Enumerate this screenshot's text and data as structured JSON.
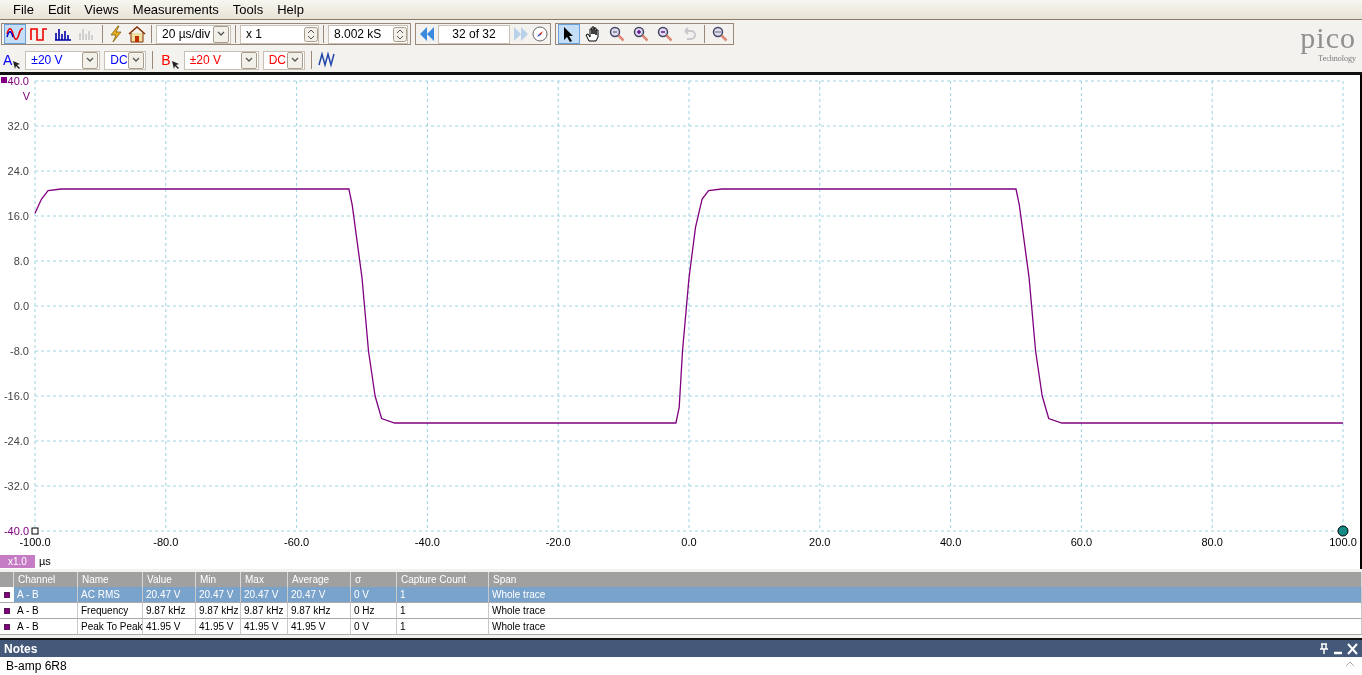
{
  "menu": [
    {
      "label": "File"
    },
    {
      "label": "Edit"
    },
    {
      "label": "Views"
    },
    {
      "label": "Measurements"
    },
    {
      "label": "Tools"
    },
    {
      "label": "Help"
    }
  ],
  "toolbar": {
    "view_modes": [
      {
        "selected": true
      },
      {
        "selected": false
      },
      {
        "selected": false
      },
      {
        "selected": false,
        "disabled": true
      }
    ],
    "timebase": "20 µs/div",
    "zoom": "x 1",
    "samples": "8.002 kS",
    "buffer": "32 of 32",
    "tools": [
      {
        "selected": true,
        "disabled": false
      },
      {
        "selected": false,
        "disabled": false
      },
      {
        "selected": false,
        "disabled": false
      },
      {
        "selected": false,
        "disabled": false
      },
      {
        "selected": false,
        "disabled": false
      },
      {
        "selected": false,
        "disabled": true
      },
      {
        "selected": false,
        "disabled": false
      }
    ]
  },
  "channels": [
    {
      "label": "A",
      "range": "±20 V",
      "coupling": "DC",
      "color": "#0000ff"
    },
    {
      "label": "B",
      "range": "±20 V",
      "coupling": "DC",
      "color": "#ff0000"
    }
  ],
  "logo": {
    "name": "pico",
    "tagline": "Technology"
  },
  "scope": {
    "y_unit": "V",
    "x_unit": "µs",
    "scale_badge": "x1.0",
    "chart_data": {
      "type": "line",
      "x": [
        -100,
        -99,
        -98,
        -96,
        -90,
        -52,
        -51.5,
        -50,
        -49,
        -48,
        -47,
        -45,
        -30,
        -2,
        -1.5,
        -1,
        0,
        1,
        2,
        3,
        5,
        20,
        50,
        50.5,
        52,
        53,
        54,
        55,
        57,
        80,
        100
      ],
      "grid": true,
      "series": [
        {
          "color": "#800080",
          "values": [
            16.5,
            19,
            20.5,
            20.8,
            20.8,
            20.8,
            18,
            5,
            -8,
            -16,
            -20,
            -20.8,
            -20.8,
            -20.8,
            -18,
            -8,
            5,
            14,
            19,
            20.5,
            20.8,
            20.8,
            20.8,
            18,
            5,
            -8,
            -16,
            -20,
            -20.8,
            -20.8,
            -20.8
          ]
        }
      ],
      "xlim": [
        -100,
        100
      ],
      "ylim": [
        -40,
        40
      ],
      "xticks": [
        {
          "value": -100,
          "label": "-100.0"
        },
        {
          "value": -80,
          "label": "-80.0"
        },
        {
          "value": -60,
          "label": "-60.0"
        },
        {
          "value": -40,
          "label": "-40.0"
        },
        {
          "value": -20,
          "label": "-20.0"
        },
        {
          "value": 0,
          "label": "0.0"
        },
        {
          "value": 20,
          "label": "20.0"
        },
        {
          "value": 40,
          "label": "40.0"
        },
        {
          "value": 60,
          "label": "60.0"
        },
        {
          "value": 80,
          "label": "80.0"
        },
        {
          "value": 100,
          "label": "100.0"
        }
      ],
      "yticks": [
        {
          "value": 40,
          "label": "40.0"
        },
        {
          "value": 32,
          "label": "32.0"
        },
        {
          "value": 24,
          "label": "24.0"
        },
        {
          "value": 16,
          "label": "16.0"
        },
        {
          "value": 8,
          "label": "8.0"
        },
        {
          "value": 0,
          "label": "0.0"
        },
        {
          "value": -8,
          "label": "-8.0"
        },
        {
          "value": -16,
          "label": "-16.0"
        },
        {
          "value": -24,
          "label": "-24.0"
        },
        {
          "value": -32,
          "label": "-32.0"
        },
        {
          "value": -40,
          "label": "-40.0"
        }
      ]
    }
  },
  "measurements": {
    "columns": [
      "Channel",
      "Name",
      "Value",
      "Min",
      "Max",
      "Average",
      "σ",
      "Capture Count",
      "Span"
    ],
    "rows": [
      {
        "selected": true,
        "cells": [
          "A - B",
          "AC RMS",
          "20.47 V",
          "20.47 V",
          "20.47 V",
          "20.47 V",
          "0 V",
          "1",
          "Whole trace"
        ]
      },
      {
        "selected": false,
        "cells": [
          "A - B",
          "Frequency",
          "9.87 kHz",
          "9.87 kHz",
          "9.87 kHz",
          "9.87 kHz",
          "0 Hz",
          "1",
          "Whole trace"
        ]
      },
      {
        "selected": false,
        "cells": [
          "A - B",
          "Peak To Peak",
          "41.95 V",
          "41.95 V",
          "41.95 V",
          "41.95 V",
          "0 V",
          "1",
          "Whole trace"
        ]
      }
    ]
  },
  "notes": {
    "title": "Notes",
    "text": "B-amp 6R8"
  }
}
